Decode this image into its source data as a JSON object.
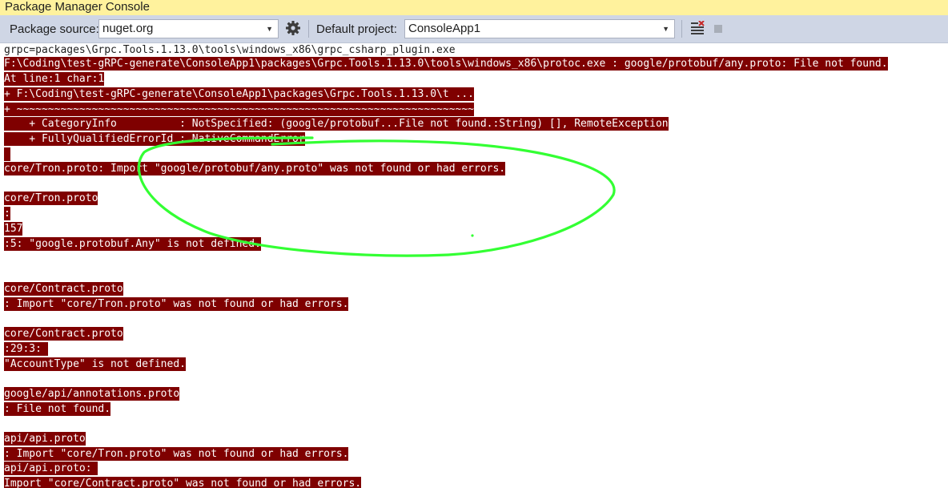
{
  "window": {
    "title": "Package Manager Console"
  },
  "toolbar": {
    "package_source_label": "Package source:",
    "package_source_value": "nuget.org",
    "default_project_label": "Default project:",
    "default_project_value": "ConsoleApp1",
    "settings_icon": "gear-icon",
    "clear_icon": "clear-console-icon",
    "stop_icon": "stop-icon"
  },
  "colors": {
    "error_background": "#7f0000",
    "error_text": "#ffffff",
    "annotation": "#33ff33"
  },
  "console": {
    "lines": [
      {
        "text": "grpc=packages\\Grpc.Tools.1.13.0\\tools\\windows_x86\\grpc_csharp_plugin.exe",
        "error": false
      },
      {
        "text": "F:\\Coding\\test-gRPC-generate\\ConsoleApp1\\packages\\Grpc.Tools.1.13.0\\tools\\windows_x86\\protoc.exe : google/protobuf/any.proto: File not found.",
        "error": true
      },
      {
        "text": "At line:1 char:1",
        "error": true
      },
      {
        "text": "+ F:\\Coding\\test-gRPC-generate\\ConsoleApp1\\packages\\Grpc.Tools.1.13.0\\t ...",
        "error": true
      },
      {
        "text": "+ ~~~~~~~~~~~~~~~~~~~~~~~~~~~~~~~~~~~~~~~~~~~~~~~~~~~~~~~~~~~~~~~~~~~~~~~~~",
        "error": true
      },
      {
        "text": "    + CategoryInfo          : NotSpecified: (google/protobuf...File not found.:String) [], RemoteException",
        "error": true
      },
      {
        "text": "    + FullyQualifiedErrorId : NativeCommandError",
        "error": true
      },
      {
        "text": " ",
        "error": true
      },
      {
        "text": "core/Tron.proto: Import \"google/protobuf/any.proto\" was not found or had errors.",
        "error": true
      },
      {
        "text": "",
        "error": false
      },
      {
        "text": "core/Tron.proto",
        "error": true
      },
      {
        "text": ":",
        "error": true
      },
      {
        "text": "157",
        "error": true
      },
      {
        "text": ":5: \"google.protobuf.Any\" is not defined.",
        "error": true
      },
      {
        "text": "",
        "error": false
      },
      {
        "text": "",
        "error": false
      },
      {
        "text": "core/Contract.proto",
        "error": true
      },
      {
        "text": ": Import \"core/Tron.proto\" was not found or had errors.",
        "error": true
      },
      {
        "text": "",
        "error": false
      },
      {
        "text": "core/Contract.proto",
        "error": true
      },
      {
        "text": ":29:3: ",
        "error": true
      },
      {
        "text": "\"AccountType\" is not defined.",
        "error": true
      },
      {
        "text": "",
        "error": false
      },
      {
        "text": "google/api/annotations.proto",
        "error": true
      },
      {
        "text": ": File not found.",
        "error": true
      },
      {
        "text": "",
        "error": false
      },
      {
        "text": "api/api.proto",
        "error": true
      },
      {
        "text": ": Import \"core/Tron.proto\" was not found or had errors.",
        "error": true
      },
      {
        "text": "api/api.proto: ",
        "error": true
      },
      {
        "text": "Import \"core/Contract.proto\" was not found or had errors.",
        "error": true
      }
    ]
  }
}
